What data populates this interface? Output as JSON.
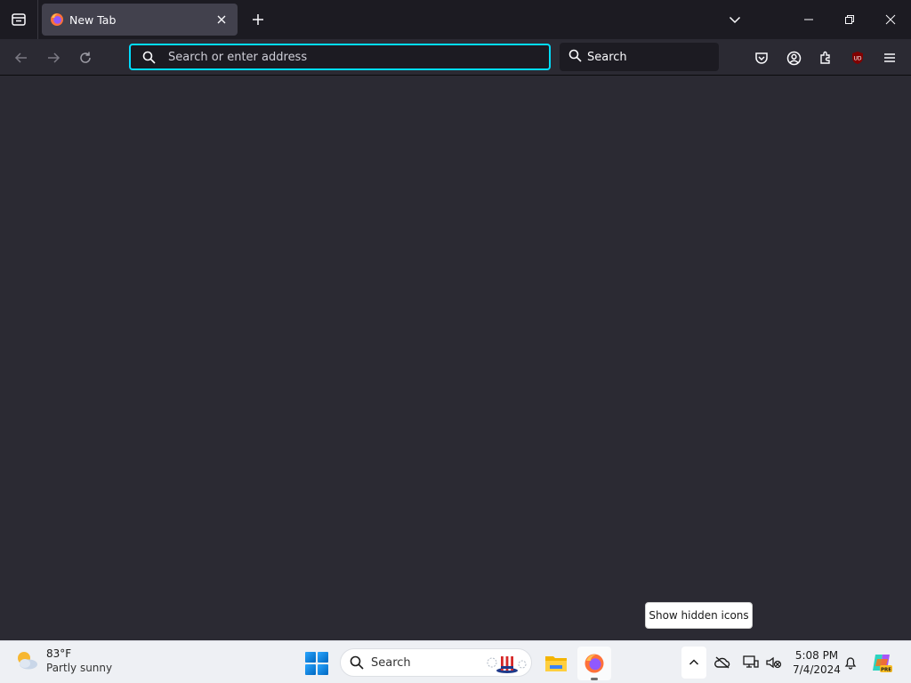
{
  "browser": {
    "tab": {
      "title": "New Tab"
    },
    "urlbar": {
      "placeholder": "Search or enter address",
      "value": ""
    },
    "searchbar": {
      "label": "Search"
    },
    "accent_color": "#00ddff",
    "extension_badge": "UD"
  },
  "tooltip": {
    "text": "Show hidden icons"
  },
  "taskbar": {
    "weather": {
      "temp": "83°F",
      "condition": "Partly sunny"
    },
    "search": {
      "label": "Search"
    },
    "clock": {
      "time": "5:08 PM",
      "date": "7/4/2024"
    },
    "copilot_badge": "PRE"
  },
  "icons": {
    "tab_list": "tab-list-icon",
    "firefox": "firefox-icon",
    "back": "back-arrow-icon",
    "forward": "forward-arrow-icon",
    "reload": "reload-icon",
    "pocket": "pocket-icon",
    "account": "account-icon",
    "extensions": "extensions-icon",
    "menu": "hamburger-menu-icon"
  }
}
